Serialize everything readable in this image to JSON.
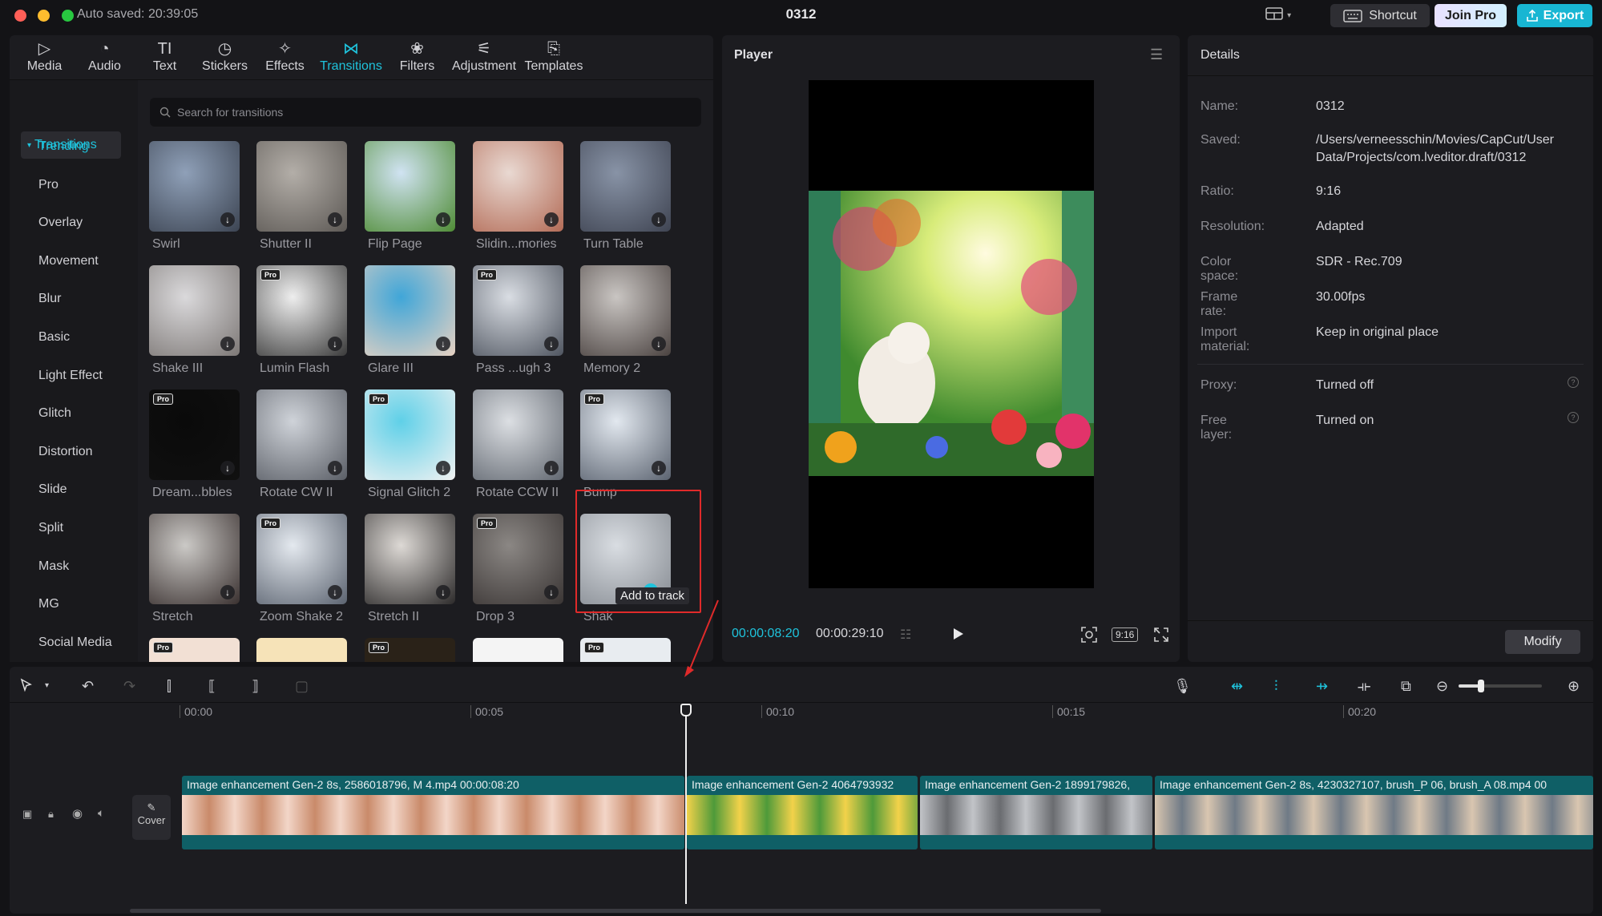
{
  "titlebar": {
    "autosaved": "Auto saved: 20:39:05",
    "project": "0312",
    "shortcut": "Shortcut",
    "join_pro": "Join Pro",
    "export": "Export"
  },
  "toolbar": [
    {
      "label": "Media",
      "icon": "media-icon"
    },
    {
      "label": "Audio",
      "icon": "audio-icon"
    },
    {
      "label": "Text",
      "icon": "text-icon"
    },
    {
      "label": "Stickers",
      "icon": "stickers-icon"
    },
    {
      "label": "Effects",
      "icon": "effects-icon"
    },
    {
      "label": "Transitions",
      "icon": "transitions-icon",
      "active": true
    },
    {
      "label": "Filters",
      "icon": "filters-icon"
    },
    {
      "label": "Adjustment",
      "icon": "adjustment-icon"
    },
    {
      "label": "Templates",
      "icon": "templates-icon"
    }
  ],
  "categories": {
    "header": "Transitions",
    "items": [
      "Trending",
      "Pro",
      "Overlay",
      "Movement",
      "Blur",
      "Basic",
      "Light Effect",
      "Glitch",
      "Distortion",
      "Slide",
      "Split",
      "Mask",
      "MG",
      "Social Media"
    ]
  },
  "search": {
    "placeholder": "Search for transitions"
  },
  "transitions": [
    {
      "label": "Swirl",
      "pro": false
    },
    {
      "label": "Shutter II",
      "pro": false
    },
    {
      "label": "Flip Page",
      "pro": false
    },
    {
      "label": "Slidin...mories",
      "pro": false
    },
    {
      "label": "Turn Table",
      "pro": false
    },
    {
      "label": "Shake III",
      "pro": false
    },
    {
      "label": "Lumin Flash",
      "pro": true
    },
    {
      "label": "Glare III",
      "pro": false
    },
    {
      "label": "Pass ...ugh 3",
      "pro": true
    },
    {
      "label": "Memory 2",
      "pro": false
    },
    {
      "label": "Dream...bbles",
      "pro": true
    },
    {
      "label": "Rotate CW II",
      "pro": false
    },
    {
      "label": "Signal Glitch 2",
      "pro": true
    },
    {
      "label": "Rotate CCW II",
      "pro": false
    },
    {
      "label": "Bump",
      "pro": true
    },
    {
      "label": "Stretch",
      "pro": false
    },
    {
      "label": "Zoom Shake 2",
      "pro": true
    },
    {
      "label": "Stretch II",
      "pro": false
    },
    {
      "label": "Drop 3",
      "pro": true
    },
    {
      "label": "Shak",
      "pro": false
    }
  ],
  "tooltip": {
    "add_to_track": "Add to track"
  },
  "pro_badge": "Pro",
  "player": {
    "title": "Player",
    "current_time": "00:00:08:20",
    "total_time": "00:00:29:10",
    "ratio_btn": "9:16"
  },
  "details": {
    "title": "Details",
    "rows": [
      {
        "key": "Name:",
        "value": "0312"
      },
      {
        "key": "Saved:",
        "value": "/Users/verneesschin/Movies/CapCut/User Data/Projects/com.lveditor.draft/0312"
      },
      {
        "key": "Ratio:",
        "value": "9:16"
      },
      {
        "key": "Resolution:",
        "value": "Adapted"
      },
      {
        "key": "Color space:",
        "value": "SDR - Rec.709"
      },
      {
        "key": "Frame rate:",
        "value": "30.00fps"
      },
      {
        "key": "Import material:",
        "value": "Keep in original place"
      },
      {
        "key": "Proxy:",
        "value": "Turned off"
      },
      {
        "key": "Free layer:",
        "value": "Turned on"
      }
    ],
    "modify": "Modify"
  },
  "timeline": {
    "ticks": [
      "00:00",
      "00:05",
      "00:10",
      "00:15",
      "00:20"
    ],
    "cover": "Cover",
    "clips": [
      {
        "label": "Image enhancement   Gen-2 8s, 2586018796, M 4.mp4   00:00:08:20"
      },
      {
        "label": "Image enhancement   Gen-2 4064793932"
      },
      {
        "label": "Image enhancement   Gen-2 1899179826,"
      },
      {
        "label": "Image enhancement   Gen-2 8s, 4230327107, brush_P 06, brush_A 08.mp4   00"
      }
    ]
  },
  "colors": {
    "accent": "#1fc3dc",
    "clip": "#0f5f66",
    "export": "#18b6d3"
  }
}
